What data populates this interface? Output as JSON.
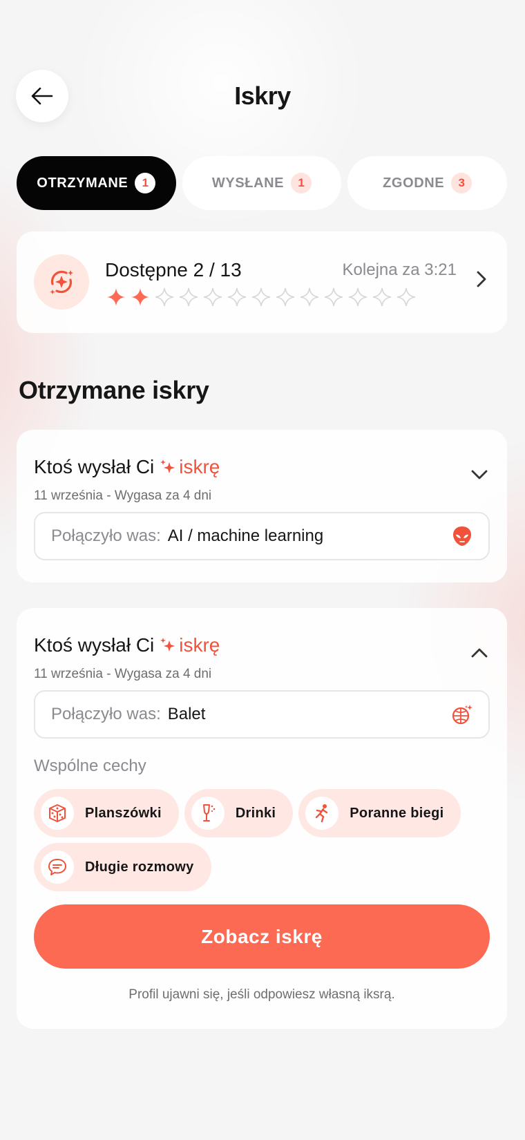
{
  "header": {
    "title": "Iskry",
    "back_icon": "arrow-left-icon"
  },
  "tabs": [
    {
      "label": "OTRZYMANE",
      "count": "1",
      "active": true
    },
    {
      "label": "WYSŁANE",
      "count": "1",
      "active": false
    },
    {
      "label": "ZGODNE",
      "count": "3",
      "active": false
    }
  ],
  "availability": {
    "title": "Dostępne 2 / 13",
    "timer": "Kolejna za 3:21",
    "filled": 2,
    "total": 13,
    "icon": "sparkle-orbit-icon"
  },
  "section_title": "Otrzymane iskry",
  "sparks": [
    {
      "head_prefix": "Ktoś wysłał Ci",
      "head_word": "iskrę",
      "subtitle": "11 września - Wygasa za 4 dni",
      "match_label": "Połączyło was:",
      "match_value": "AI / machine learning",
      "match_icon": "alien-icon",
      "expanded": false
    },
    {
      "head_prefix": "Ktoś wysłał Ci",
      "head_word": "iskrę",
      "subtitle": "11 września - Wygasa za 4 dni",
      "match_label": "Połączyło was:",
      "match_value": "Balet",
      "match_icon": "disco-ball-icon",
      "expanded": true,
      "traits_title": "Wspólne cechy",
      "traits": [
        {
          "label": "Planszówki",
          "icon": "dice-icon"
        },
        {
          "label": "Drinki",
          "icon": "champagne-glass-icon"
        },
        {
          "label": "Poranne biegi",
          "icon": "running-person-icon"
        },
        {
          "label": "Długie rozmowy",
          "icon": "chat-bubble-icon"
        }
      ],
      "cta": "Zobacz iskrę",
      "footnote": "Profil ujawni się, jeśli odpowiesz własną iksrą."
    }
  ],
  "colors": {
    "accent": "#fc6a54",
    "accent_text": "#f0523c",
    "chip_bg": "#ffe8e3",
    "active_tab": "#050505"
  }
}
